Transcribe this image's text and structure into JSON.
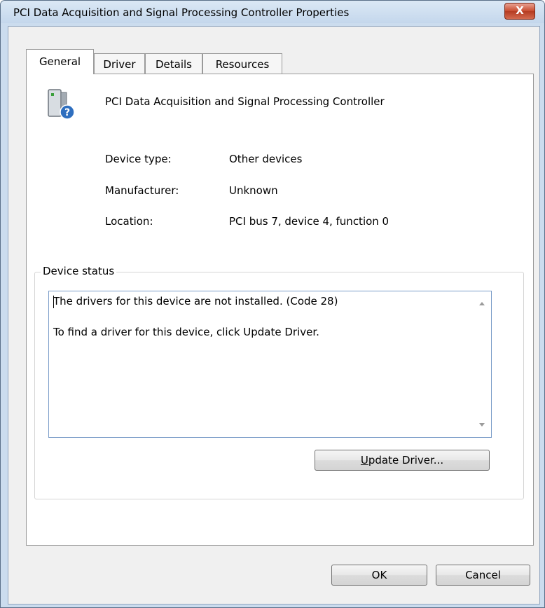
{
  "window": {
    "title": "PCI Data Acquisition and Signal Processing Controller Properties",
    "close_label": "X"
  },
  "tabs": [
    {
      "label": "General",
      "active": true
    },
    {
      "label": "Driver",
      "active": false
    },
    {
      "label": "Details",
      "active": false
    },
    {
      "label": "Resources",
      "active": false
    }
  ],
  "general": {
    "device_name": "PCI Data Acquisition and Signal Processing Controller",
    "device_icon": "unknown-device-icon",
    "properties": [
      {
        "label": "Device type:",
        "value": "Other devices"
      },
      {
        "label": "Manufacturer:",
        "value": "Unknown"
      },
      {
        "label": "Location:",
        "value": "PCI bus 7, device 4, function 0"
      }
    ],
    "status_group_label": "Device status",
    "status_lines": [
      "The drivers for this device are not installed. (Code 28)",
      "To find a driver for this device, click Update Driver."
    ],
    "update_driver": {
      "mnemonic": "U",
      "rest": "pdate Driver..."
    }
  },
  "footer": {
    "ok_label": "OK",
    "cancel_label": "Cancel"
  }
}
